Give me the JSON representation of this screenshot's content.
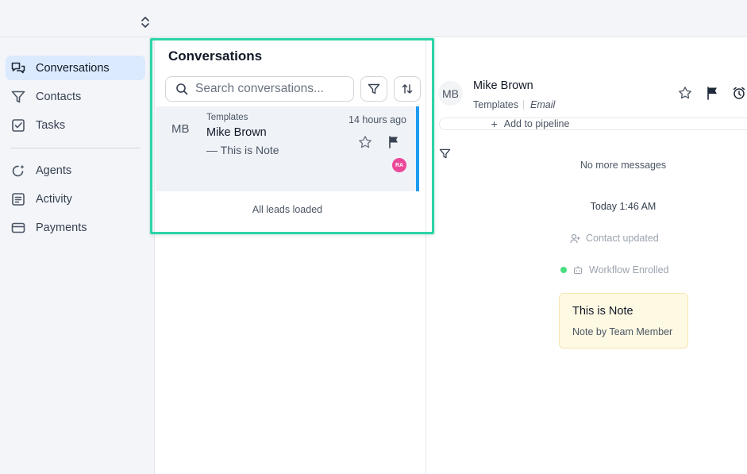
{
  "sidebar": {
    "items": [
      {
        "label": "Conversations",
        "icon": "chat-bubbles-icon",
        "active": true
      },
      {
        "label": "Contacts",
        "icon": "funnel-icon",
        "active": false
      },
      {
        "label": "Tasks",
        "icon": "checkbox-icon",
        "active": false
      },
      {
        "label": "Agents",
        "icon": "sparkle-agent-icon",
        "active": false
      },
      {
        "label": "Activity",
        "icon": "list-doc-icon",
        "active": false
      },
      {
        "label": "Payments",
        "icon": "credit-card-icon",
        "active": false
      }
    ]
  },
  "list": {
    "title": "Conversations",
    "search_placeholder": "Search conversations...",
    "conversation": {
      "avatar": "MB",
      "source": "Templates",
      "name": "Mike Brown",
      "preview": "—  This is Note",
      "time": "14 hours ago",
      "badge": "RA"
    },
    "footer": "All leads loaded"
  },
  "detail": {
    "avatar": "MB",
    "name": "Mike Brown",
    "source": "Templates",
    "channel": "Email",
    "add_pipeline": "Add to pipeline",
    "no_more": "No more messages",
    "timestamp": "Today 1:46 AM",
    "contact_updated": "Contact updated",
    "workflow": "Workflow Enrolled",
    "note": {
      "title": "This is Note",
      "by": "Note by Team Member"
    }
  },
  "colors": {
    "accent": "#1d9bf0",
    "highlight": "#2dd4a7",
    "badge": "#ec4899",
    "note_bg": "#fef9e3"
  }
}
